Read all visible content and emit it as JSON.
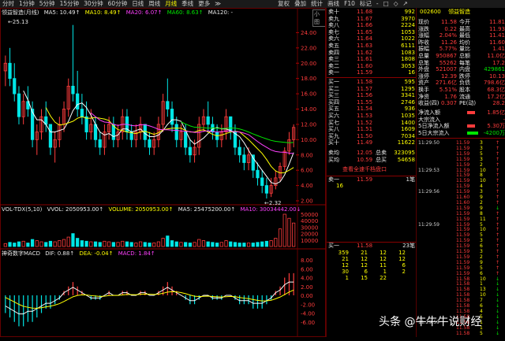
{
  "toolbar": {
    "items": [
      "分时",
      "1分钟",
      "5分钟",
      "15分钟",
      "30分钟",
      "60分钟",
      "日线",
      "周线",
      "月线",
      "季线",
      "更多",
      "≫"
    ],
    "active_index": 8,
    "right_items": [
      "复权",
      "叠加",
      "统计",
      "画线",
      "F10",
      "标记",
      "-",
      "□",
      "◇",
      "↗"
    ]
  },
  "main_legend": {
    "name": "领益智造(月线)",
    "ma5": "MA5: 10.49↑",
    "ma10": "MA10: 8.49↑",
    "ma20": "MA20: 6.07↑",
    "ma60": "MA60: 8.63↑",
    "ma120": "MA120: -"
  },
  "main_chart": {
    "high_label": "25.13",
    "low_label": "2.32",
    "y_labels": [
      "24.00",
      "22.00",
      "20.00",
      "18.00",
      "16.00",
      "14.00",
      "12.00",
      "10.00",
      "8.00",
      "6.00",
      "4.00",
      "2.00"
    ],
    "badge": "小图"
  },
  "vol_legend": {
    "name": "VOL-TDX(5,10)",
    "vvol": "VVOL: 2050953.00↑",
    "volume": "VOLUME: 2050953.00↑",
    "ma5": "MA5: 2547520​0.00↑",
    "ma10": "MA10: 30034442.00↓"
  },
  "vol_chart": {
    "y_labels": [
      "50000",
      "40000",
      "30000",
      "20000",
      "10000"
    ]
  },
  "macd_legend": {
    "name": "神奇数字MACD",
    "dif": "DIF: 0.88↑",
    "dea": "DEA: -0.04↑",
    "macd": "MACD: 1.84↑"
  },
  "macd_chart": {
    "y_labels": [
      "8.00",
      "6.00",
      "4.00",
      "2.00",
      "0.00",
      "-2.00",
      "-4.00",
      "-6.00"
    ],
    "bottom_label": "-8.00"
  },
  "order_book": {
    "asks": [
      {
        "label": "卖十",
        "price": "11.68",
        "vol": "992"
      },
      {
        "label": "卖九",
        "price": "11.67",
        "vol": "3970"
      },
      {
        "label": "卖八",
        "price": "11.66",
        "vol": "2224"
      },
      {
        "label": "卖七",
        "price": "11.65",
        "vol": "1053"
      },
      {
        "label": "卖六",
        "price": "11.64",
        "vol": "1022"
      },
      {
        "label": "卖五",
        "price": "11.63",
        "vol": "6111"
      },
      {
        "label": "卖四",
        "price": "11.62",
        "vol": "1083"
      },
      {
        "label": "卖三",
        "price": "11.61",
        "vol": "1808"
      },
      {
        "label": "卖二",
        "price": "11.60",
        "vol": "3053"
      },
      {
        "label": "卖一",
        "price": "11.59",
        "vol": "16"
      }
    ],
    "bids": [
      {
        "label": "买一",
        "price": "11.58",
        "vol": "595"
      },
      {
        "label": "买二",
        "price": "11.57",
        "vol": "1295"
      },
      {
        "label": "买三",
        "price": "11.56",
        "vol": "3341"
      },
      {
        "label": "买四",
        "price": "11.55",
        "vol": "2746"
      },
      {
        "label": "买五",
        "price": "11.54",
        "vol": "936"
      },
      {
        "label": "买六",
        "price": "11.53",
        "vol": "1035"
      },
      {
        "label": "买七",
        "price": "11.52",
        "vol": "1400"
      },
      {
        "label": "买八",
        "price": "11.51",
        "vol": "1609"
      },
      {
        "label": "买九",
        "price": "11.50",
        "vol": "7034"
      },
      {
        "label": "买十",
        "price": "11.49",
        "vol": "11622"
      }
    ],
    "avg_ask": {
      "label": "卖均",
      "price": "12.05",
      "sum_label": "总卖",
      "sum": "323095"
    },
    "avg_bid": {
      "label": "买均",
      "price": "10.59",
      "sum_label": "总买",
      "sum": "54658"
    },
    "queue_link": "查看全速千档盘口",
    "ask_queue": {
      "label": "卖一",
      "price": "11.59",
      "count": "1笔",
      "orders": [
        "16"
      ]
    },
    "bid_queue": {
      "label": "买一",
      "price": "11.58",
      "count": "23笔",
      "rows": [
        [
          "359",
          "21",
          "12",
          "12"
        ],
        [
          "21",
          "12",
          "12",
          "12"
        ],
        [
          "12",
          "12",
          "11",
          "6"
        ],
        [
          "30",
          "6",
          "1",
          "2"
        ],
        [
          "1",
          "15",
          "22",
          ""
        ]
      ]
    }
  },
  "quote": {
    "code": "002600",
    "name": "领益智造",
    "rows": [
      {
        "k1": "现价",
        "v1": "11.58",
        "k2": "今开",
        "v2": "11.81"
      },
      {
        "k1": "涨跌",
        "v1": "0.22",
        "k2": "最高",
        "v2": "11.93"
      },
      {
        "k1": "涨幅",
        "v1": "2.04%",
        "k2": "最低",
        "v2": "11.41"
      },
      {
        "k1": "昨收",
        "v1": "11.26",
        "k2": "均价",
        "v2": "11.60"
      },
      {
        "k1": "振幅",
        "v1": "5.77%",
        "k2": "量比",
        "v2": "1.41"
      },
      {
        "k1": "总量",
        "v1": "950867",
        "k2": "总额",
        "v2": "11.0亿"
      },
      {
        "k1": "总笔",
        "v1": "55262",
        "k2": "每笔",
        "v2": "17.2"
      },
      {
        "k1": "外盘",
        "v1": "521007",
        "k2": "内盘",
        "v2": "429861"
      },
      {
        "k1": "涨停",
        "v1": "12.39",
        "k2": "跌停",
        "v2": "10.13"
      },
      {
        "k1": "资产",
        "v1": "271.6亿",
        "k2": "负债",
        "v2": "798.6亿"
      },
      {
        "k1": "换手",
        "v1": "5.51%",
        "k2": "股本",
        "v2": "68.3亿"
      },
      {
        "k1": "净资",
        "v1": "1.76",
        "k2": "流通",
        "v2": "17.2亿"
      },
      {
        "k1": "收益(四)",
        "v1": "0.307",
        "k2": "PE(动)",
        "v2": "28.2"
      }
    ],
    "flows": [
      {
        "k": "净流入额",
        "v": "1.85亿"
      },
      {
        "k": "大宗流入",
        "v": "-"
      },
      {
        "k": "5日净流入额",
        "v": "5.30万"
      },
      {
        "k": "5日大宗流入",
        "v": "-4200万"
      }
    ]
  },
  "ticks": [
    {
      "t": "11:29:50",
      "p": "11.59",
      "v": "3",
      "d": "↑"
    },
    {
      "t": "",
      "p": "11.59",
      "v": "3",
      "d": "↑"
    },
    {
      "t": "",
      "p": "11.59",
      "v": "5",
      "d": "↑"
    },
    {
      "t": "",
      "p": "11.59",
      "v": "3",
      "d": "↑"
    },
    {
      "t": "",
      "p": "11.59",
      "v": "2",
      "d": "↑"
    },
    {
      "t": "11:29:53",
      "p": "11.59",
      "v": "10",
      "d": "↑"
    },
    {
      "t": "",
      "p": "11.59",
      "v": "8",
      "d": "↑"
    },
    {
      "t": "",
      "p": "11.59",
      "v": "10",
      "d": "↑"
    },
    {
      "t": "",
      "p": "11.59",
      "v": "4",
      "d": "↑"
    },
    {
      "t": "11:29:56",
      "p": "11.59",
      "v": "3",
      "d": "↑"
    },
    {
      "t": "",
      "p": "11.60",
      "v": "9",
      "d": "↑"
    },
    {
      "t": "",
      "p": "11.60",
      "v": "2",
      "d": "↑"
    },
    {
      "t": "",
      "p": "11.59",
      "v": "9",
      "d": "↓"
    },
    {
      "t": "",
      "p": "11.59",
      "v": "8",
      "d": "↑"
    },
    {
      "t": "",
      "p": "11.59",
      "v": "11",
      "d": "↑"
    },
    {
      "t": "11:29:59",
      "p": "11.59",
      "v": "5",
      "d": "↑"
    },
    {
      "t": "",
      "p": "11.59",
      "v": "10",
      "d": "↑"
    },
    {
      "t": "",
      "p": "11.59",
      "v": "5",
      "d": "↑"
    },
    {
      "t": "",
      "p": "11.59",
      "v": "3",
      "d": "↑"
    },
    {
      "t": "",
      "p": "11.59",
      "v": "6",
      "d": "↑"
    },
    {
      "t": "",
      "p": "11.59",
      "v": "3",
      "d": "↑"
    },
    {
      "t": "",
      "p": "11.59",
      "v": "2",
      "d": "↑"
    },
    {
      "t": "",
      "p": "11.59",
      "v": "9",
      "d": "↑"
    },
    {
      "t": "",
      "p": "11.59",
      "v": "5",
      "d": "↑"
    },
    {
      "t": "",
      "p": "11.59",
      "v": "6",
      "d": "↑"
    },
    {
      "t": "",
      "p": "11.58",
      "v": "10",
      "d": "↓"
    },
    {
      "t": "",
      "p": "11.58",
      "v": "1",
      "d": "↓"
    },
    {
      "t": "",
      "p": "11.58",
      "v": "13",
      "d": "↓"
    },
    {
      "t": "",
      "p": "11.58",
      "v": "10",
      "d": "↓"
    },
    {
      "t": "",
      "p": "11.58",
      "v": "7",
      "d": "↓"
    },
    {
      "t": "",
      "p": "11.58",
      "v": "6",
      "d": "↓"
    },
    {
      "t": "",
      "p": "11.58",
      "v": "4",
      "d": "↓"
    },
    {
      "t": "",
      "p": "11.58",
      "v": "5",
      "d": "↓"
    },
    {
      "t": "11:29:59",
      "p": "11.58",
      "v": "1",
      "d": "↓"
    },
    {
      "t": "",
      "p": "11.58",
      "v": "1",
      "d": "↓"
    },
    {
      "t": "",
      "p": "11.58",
      "v": "5",
      "d": "↓"
    }
  ],
  "watermark": "头条 @牛牛牛说财经",
  "chart_data": {
    "type": "candlestick",
    "ylim": [
      2,
      26
    ],
    "candles": [
      [
        19,
        21,
        17,
        20
      ],
      [
        20,
        22,
        17,
        18
      ],
      [
        18,
        20,
        15,
        16
      ],
      [
        16,
        17,
        12,
        13
      ],
      [
        13,
        16,
        12,
        15
      ],
      [
        15,
        17,
        13,
        14
      ],
      [
        14,
        15,
        9,
        10
      ],
      [
        10,
        12,
        8,
        11
      ],
      [
        11,
        14,
        10,
        13
      ],
      [
        13,
        15,
        11,
        12
      ],
      [
        12,
        12,
        8,
        9
      ],
      [
        9,
        11,
        7,
        10
      ],
      [
        10,
        13,
        9,
        12
      ],
      [
        12,
        15,
        11,
        14
      ],
      [
        14,
        18,
        13,
        17
      ],
      [
        17,
        25,
        15,
        16
      ],
      [
        16,
        19,
        13,
        14
      ],
      [
        14,
        16,
        12,
        13
      ],
      [
        13,
        15,
        10,
        11
      ],
      [
        11,
        14,
        10,
        12
      ],
      [
        12,
        13,
        9,
        10
      ],
      [
        10,
        11,
        8,
        9
      ],
      [
        9,
        12,
        8,
        11
      ],
      [
        11,
        13,
        10,
        12
      ],
      [
        12,
        13,
        9,
        10
      ],
      [
        10,
        12,
        9,
        11
      ],
      [
        11,
        14,
        10,
        13
      ],
      [
        13,
        14,
        10,
        11
      ],
      [
        11,
        12,
        9,
        10
      ],
      [
        10,
        12,
        9,
        11
      ],
      [
        11,
        13,
        10,
        12
      ],
      [
        12,
        12,
        9,
        10
      ],
      [
        10,
        11,
        8,
        9
      ],
      [
        9,
        11,
        8,
        10
      ],
      [
        10,
        13,
        9,
        12
      ],
      [
        12,
        16,
        11,
        15
      ],
      [
        15,
        18,
        13,
        14
      ],
      [
        14,
        15,
        11,
        12
      ],
      [
        12,
        13,
        9,
        10
      ],
      [
        10,
        12,
        9,
        11
      ],
      [
        11,
        12,
        8,
        9
      ],
      [
        9,
        10,
        7,
        8
      ],
      [
        8,
        10,
        7,
        9
      ],
      [
        9,
        13,
        8,
        12
      ],
      [
        12,
        14,
        11,
        13
      ],
      [
        13,
        15,
        11,
        12
      ],
      [
        12,
        13,
        10,
        11
      ],
      [
        11,
        12,
        9,
        10
      ],
      [
        10,
        12,
        9,
        11
      ],
      [
        11,
        14,
        10,
        13
      ],
      [
        13,
        13,
        10,
        11
      ],
      [
        11,
        12,
        8,
        9
      ],
      [
        9,
        10,
        7,
        8
      ],
      [
        8,
        9,
        6,
        7
      ],
      [
        7,
        9,
        6,
        8
      ],
      [
        8,
        8,
        5,
        6
      ],
      [
        6,
        7,
        4,
        5
      ],
      [
        5,
        6,
        3,
        4
      ],
      [
        4,
        5,
        2.3,
        3
      ],
      [
        3,
        5,
        2.5,
        4
      ],
      [
        4,
        6,
        3.5,
        5
      ],
      [
        5,
        7,
        4.5,
        6.5
      ],
      [
        6.5,
        9,
        6,
        8.5
      ],
      [
        8.5,
        11,
        8,
        10
      ],
      [
        10,
        12,
        9,
        11.6
      ]
    ],
    "volumes": [
      5,
      7,
      6,
      8,
      9,
      6,
      12,
      10,
      8,
      7,
      9,
      8,
      10,
      12,
      16,
      22,
      14,
      10,
      9,
      8,
      8,
      7,
      9,
      8,
      7,
      7,
      9,
      8,
      7,
      6,
      8,
      7,
      6,
      6,
      8,
      14,
      18,
      10,
      8,
      7,
      7,
      6,
      7,
      12,
      10,
      8,
      7,
      6,
      7,
      10,
      8,
      7,
      6,
      6,
      6,
      6,
      7,
      8,
      9,
      10,
      14,
      30,
      55,
      48,
      40
    ],
    "macd": [
      -4,
      -5,
      -6,
      -7,
      -7,
      -6,
      -6,
      -5,
      -4,
      -3,
      -3,
      -2,
      -1,
      1,
      2,
      3,
      2,
      1,
      0,
      -1,
      -1,
      -1,
      0,
      1,
      0,
      0,
      1,
      1,
      0,
      0,
      1,
      1,
      0,
      0,
      1,
      2,
      3,
      2,
      1,
      0,
      -1,
      -2,
      -2,
      -1,
      0,
      0,
      -1,
      -1,
      -1,
      0,
      0,
      -1,
      -2,
      -2,
      -2,
      -3,
      -3,
      -3,
      -2,
      -1,
      1,
      2,
      4,
      5,
      5
    ]
  }
}
